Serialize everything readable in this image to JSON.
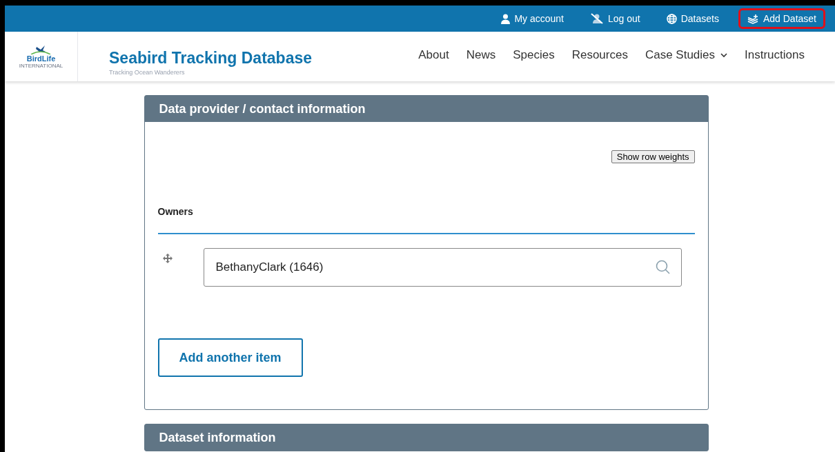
{
  "top_bar": {
    "links": [
      {
        "label": "My account",
        "highlighted": false
      },
      {
        "label": "Log out",
        "highlighted": false
      },
      {
        "label": "Datasets",
        "highlighted": false
      },
      {
        "label": "Add Dataset",
        "highlighted": true
      }
    ]
  },
  "header": {
    "logo": {
      "name": "BirdLife",
      "subtitle": "INTERNATIONAL"
    },
    "title": "Seabird Tracking Database",
    "tagline": "Tracking Ocean Wanderers",
    "nav": [
      {
        "label": "About",
        "dropdown": false
      },
      {
        "label": "News",
        "dropdown": false
      },
      {
        "label": "Species",
        "dropdown": false
      },
      {
        "label": "Resources",
        "dropdown": false
      },
      {
        "label": "Case Studies",
        "dropdown": true
      },
      {
        "label": "Instructions",
        "dropdown": false
      }
    ]
  },
  "sections": [
    {
      "title": "Data provider / contact information",
      "row_weights_button": "Show row weights",
      "field_label": "Owners",
      "items": [
        {
          "value": "BethanyClark (1646)"
        }
      ],
      "add_button": "Add another item"
    },
    {
      "title": "Dataset information"
    }
  ]
}
